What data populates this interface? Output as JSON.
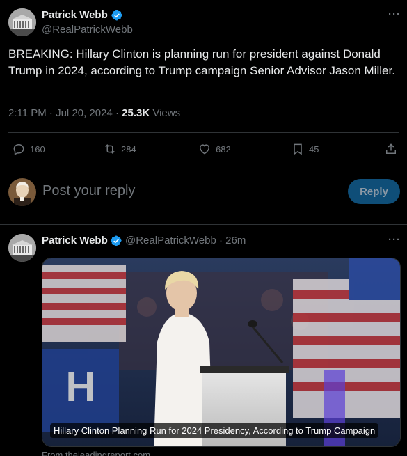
{
  "main_tweet": {
    "author_name": "Patrick Webb",
    "author_handle": "@RealPatrickWebb",
    "text": "BREAKING: Hillary Clinton is planning run for president against Donald Trump in 2024, according to Trump campaign Senior Advisor Jason Miller.",
    "time": "2:11 PM · Jul 20, 2024 · ",
    "views_count": "25.3K",
    "views_label": " Views",
    "more_icon": "more-icon"
  },
  "actions": {
    "replies": "160",
    "retweets": "284",
    "likes": "682",
    "bookmarks": "45"
  },
  "reply_box": {
    "placeholder": "Post your reply",
    "button_label": "Reply"
  },
  "reply_tweet": {
    "author_name": "Patrick Webb",
    "handle_time": "@RealPatrickWebb · 26m",
    "media_caption": "Hillary Clinton Planning Run for 2024 Presidency, According to Trump Campaign",
    "source": "From theleadingreport.com"
  },
  "colors": {
    "accent": "#1d9bf0",
    "reply_button_bg": "#0f4e78",
    "muted": "#71767b",
    "divider": "#2f3336"
  }
}
